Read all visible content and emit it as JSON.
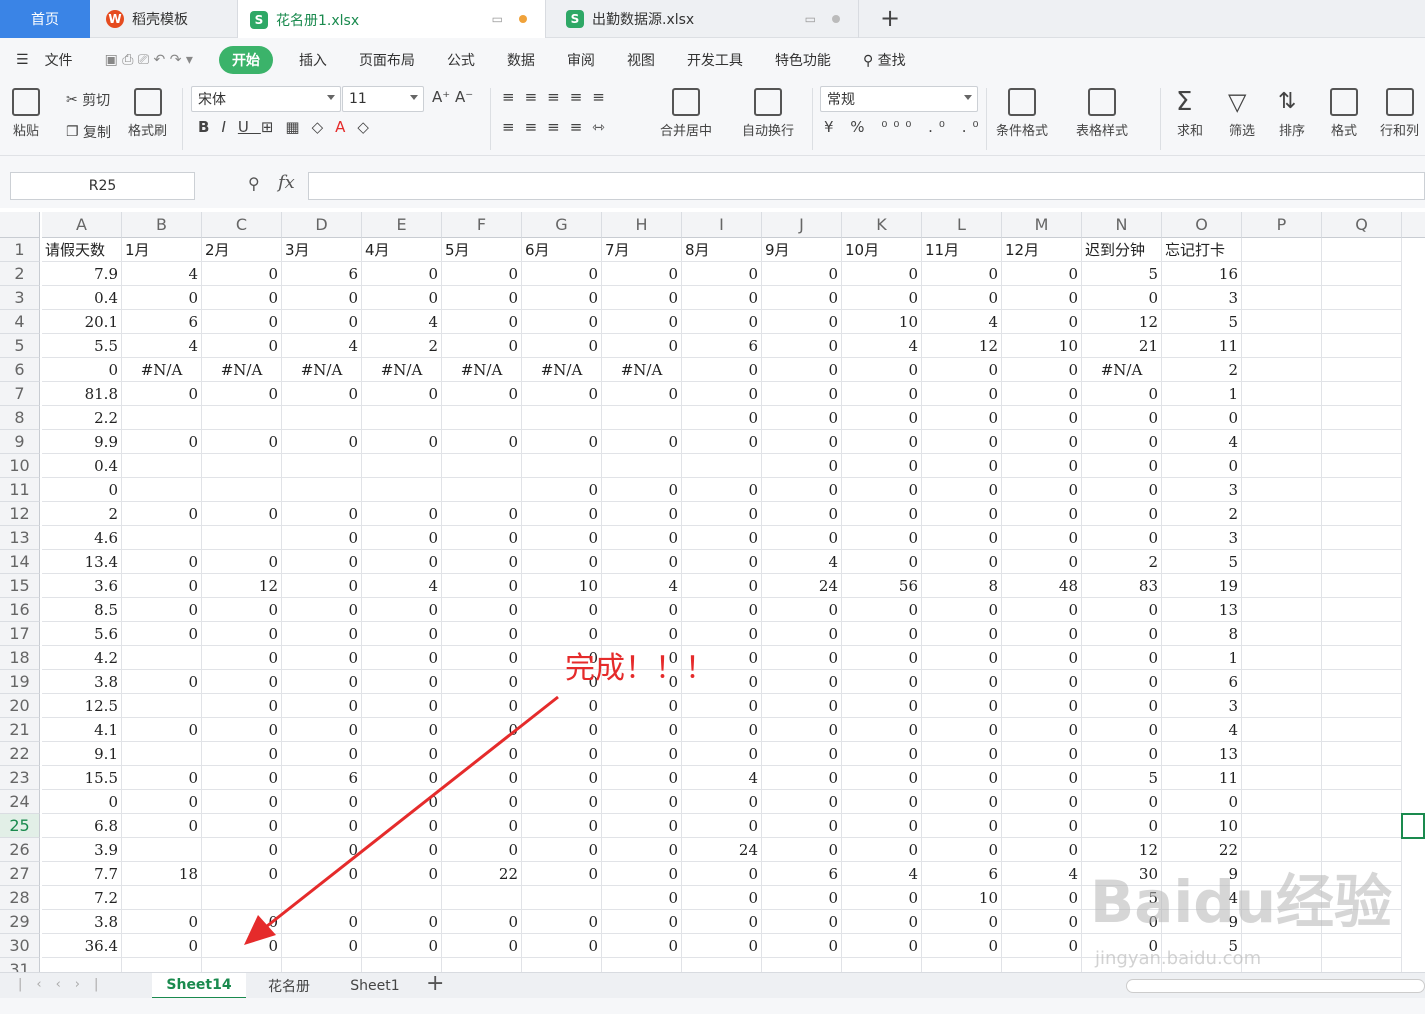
{
  "tabs": {
    "home": "首页",
    "template": "稻壳模板",
    "file1": "花名册1.xlsx",
    "file2": "出勤数据源.xlsx"
  },
  "menu": [
    "文件",
    "开始",
    "插入",
    "页面布局",
    "公式",
    "数据",
    "审阅",
    "视图",
    "开发工具",
    "特色功能",
    "查找"
  ],
  "ribbon": {
    "paste": "粘贴",
    "cut": "剪切",
    "copy": "复制",
    "format_painter": "格式刷",
    "font": "宋体",
    "size": "11",
    "merge": "合并居中",
    "wrap": "自动换行",
    "number_format": "常规",
    "cond_format": "条件格式",
    "table_style": "表格样式",
    "sum": "求和",
    "filter": "筛选",
    "sort": "排序",
    "format": "格式",
    "rowcol": "行和列"
  },
  "namebox": "R25",
  "fx": "fx",
  "columns": [
    "A",
    "B",
    "C",
    "D",
    "E",
    "F",
    "G",
    "H",
    "I",
    "J",
    "K",
    "L",
    "M",
    "N",
    "O",
    "P",
    "Q"
  ],
  "headers": [
    "请假天数",
    "1月",
    "2月",
    "3月",
    "4月",
    "5月",
    "6月",
    "7月",
    "8月",
    "9月",
    "10月",
    "11月",
    "12月",
    "迟到分钟",
    "忘记打卡"
  ],
  "rows": [
    [
      "7.9",
      "4",
      "0",
      "6",
      "0",
      "0",
      "0",
      "0",
      "0",
      "0",
      "0",
      "0",
      "0",
      "5",
      "16"
    ],
    [
      "0.4",
      "0",
      "0",
      "0",
      "0",
      "0",
      "0",
      "0",
      "0",
      "0",
      "0",
      "0",
      "0",
      "0",
      "3"
    ],
    [
      "20.1",
      "6",
      "0",
      "0",
      "4",
      "0",
      "0",
      "0",
      "0",
      "0",
      "10",
      "4",
      "0",
      "12",
      "5"
    ],
    [
      "5.5",
      "4",
      "0",
      "4",
      "2",
      "0",
      "0",
      "0",
      "6",
      "0",
      "4",
      "12",
      "10",
      "21",
      "11"
    ],
    [
      "0",
      "#N/A",
      "#N/A",
      "#N/A",
      "#N/A",
      "#N/A",
      "#N/A",
      "#N/A",
      "0",
      "0",
      "0",
      "0",
      "0",
      "#N/A",
      "2"
    ],
    [
      "81.8",
      "0",
      "0",
      "0",
      "0",
      "0",
      "0",
      "0",
      "0",
      "0",
      "0",
      "0",
      "0",
      "0",
      "1"
    ],
    [
      "2.2",
      "",
      "",
      "",
      "",
      "",
      "",
      "",
      "0",
      "0",
      "0",
      "0",
      "0",
      "0",
      "0"
    ],
    [
      "9.9",
      "0",
      "0",
      "0",
      "0",
      "0",
      "0",
      "0",
      "0",
      "0",
      "0",
      "0",
      "0",
      "0",
      "4"
    ],
    [
      "0.4",
      "",
      "",
      "",
      "",
      "",
      "",
      "",
      "",
      "0",
      "0",
      "0",
      "0",
      "0",
      "0"
    ],
    [
      "0",
      "",
      "",
      "",
      "",
      "",
      "0",
      "0",
      "0",
      "0",
      "0",
      "0",
      "0",
      "0",
      "3"
    ],
    [
      "2",
      "0",
      "0",
      "0",
      "0",
      "0",
      "0",
      "0",
      "0",
      "0",
      "0",
      "0",
      "0",
      "0",
      "2"
    ],
    [
      "4.6",
      "",
      "",
      "0",
      "0",
      "0",
      "0",
      "0",
      "0",
      "0",
      "0",
      "0",
      "0",
      "0",
      "3"
    ],
    [
      "13.4",
      "0",
      "0",
      "0",
      "0",
      "0",
      "0",
      "0",
      "0",
      "4",
      "0",
      "0",
      "0",
      "2",
      "5"
    ],
    [
      "3.6",
      "0",
      "12",
      "0",
      "4",
      "0",
      "10",
      "4",
      "0",
      "24",
      "56",
      "8",
      "48",
      "83",
      "19"
    ],
    [
      "8.5",
      "0",
      "0",
      "0",
      "0",
      "0",
      "0",
      "0",
      "0",
      "0",
      "0",
      "0",
      "0",
      "0",
      "13"
    ],
    [
      "5.6",
      "0",
      "0",
      "0",
      "0",
      "0",
      "0",
      "0",
      "0",
      "0",
      "0",
      "0",
      "0",
      "0",
      "8"
    ],
    [
      "4.2",
      "",
      "0",
      "0",
      "0",
      "0",
      "0",
      "0",
      "0",
      "0",
      "0",
      "0",
      "0",
      "0",
      "1"
    ],
    [
      "3.8",
      "0",
      "0",
      "0",
      "0",
      "0",
      "0",
      "0",
      "0",
      "0",
      "0",
      "0",
      "0",
      "0",
      "6"
    ],
    [
      "12.5",
      "",
      "0",
      "0",
      "0",
      "0",
      "0",
      "0",
      "0",
      "0",
      "0",
      "0",
      "0",
      "0",
      "3"
    ],
    [
      "4.1",
      "0",
      "0",
      "0",
      "0",
      "0",
      "0",
      "0",
      "0",
      "0",
      "0",
      "0",
      "0",
      "0",
      "4"
    ],
    [
      "9.1",
      "",
      "0",
      "0",
      "0",
      "0",
      "0",
      "0",
      "0",
      "0",
      "0",
      "0",
      "0",
      "0",
      "13"
    ],
    [
      "15.5",
      "0",
      "0",
      "6",
      "0",
      "0",
      "0",
      "0",
      "4",
      "0",
      "0",
      "0",
      "0",
      "5",
      "11"
    ],
    [
      "0",
      "0",
      "0",
      "0",
      "0",
      "0",
      "0",
      "0",
      "0",
      "0",
      "0",
      "0",
      "0",
      "0",
      "0"
    ],
    [
      "6.8",
      "0",
      "0",
      "0",
      "0",
      "0",
      "0",
      "0",
      "0",
      "0",
      "0",
      "0",
      "0",
      "0",
      "10"
    ],
    [
      "3.9",
      "",
      "0",
      "0",
      "0",
      "0",
      "0",
      "0",
      "24",
      "0",
      "0",
      "0",
      "0",
      "12",
      "22"
    ],
    [
      "7.7",
      "18",
      "0",
      "0",
      "0",
      "22",
      "0",
      "0",
      "0",
      "6",
      "4",
      "6",
      "4",
      "30",
      "9"
    ],
    [
      "7.2",
      "",
      "",
      "",
      "",
      "",
      "",
      "0",
      "0",
      "0",
      "0",
      "10",
      "0",
      "5",
      "4"
    ],
    [
      "3.8",
      "0",
      "0",
      "0",
      "0",
      "0",
      "0",
      "0",
      "0",
      "0",
      "0",
      "0",
      "0",
      "0",
      "9"
    ],
    [
      "36.4",
      "0",
      "0",
      "0",
      "0",
      "0",
      "0",
      "0",
      "0",
      "0",
      "0",
      "0",
      "0",
      "0",
      "5"
    ]
  ],
  "annotation": "完成！！！",
  "watermark": "Baidu经验",
  "watermark_url": "jingyan.baidu.com",
  "sheets": [
    "Sheet14",
    "花名册",
    "Sheet1"
  ]
}
